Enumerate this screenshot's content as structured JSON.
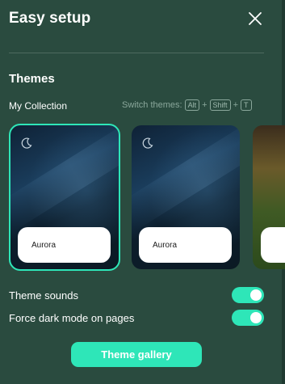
{
  "panel": {
    "title": "Easy setup",
    "close_icon": "close-icon"
  },
  "themes": {
    "section_title": "Themes",
    "collection_label": "My Collection",
    "shortcut": {
      "label": "Switch themes:",
      "keys": [
        "Alt",
        "Shift",
        "T"
      ],
      "separator": "+"
    },
    "cards": [
      {
        "name": "Aurora",
        "icon": "moon-icon",
        "selected": true
      },
      {
        "name": "Aurora",
        "icon": "moon-icon",
        "selected": false
      }
    ]
  },
  "settings": {
    "theme_sounds_label": "Theme sounds",
    "theme_sounds_on": true,
    "force_dark_label": "Force dark mode on pages",
    "force_dark_on": true
  },
  "gallery_button_label": "Theme gallery",
  "colors": {
    "background": "#2a4b3f",
    "accent": "#2ee6b8",
    "muted_text": "#8aa79b"
  }
}
